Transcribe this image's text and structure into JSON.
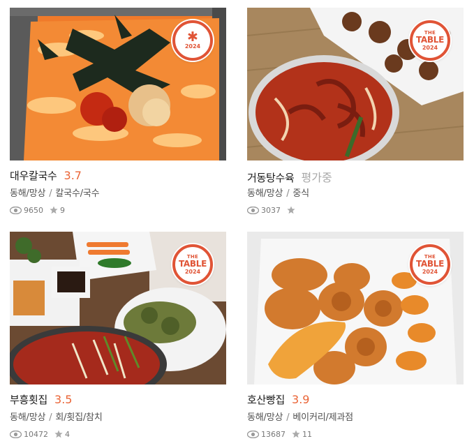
{
  "restaurants": [
    {
      "name": "대우칼국수",
      "rating": "3.7",
      "location": "동해/망상",
      "category": "칼국수/국수",
      "views": "9650",
      "reviews": "9",
      "badge": {
        "type": "star",
        "symbol": "✱",
        "year": "2024"
      },
      "image": "spicy-noodle-soup-photo"
    },
    {
      "name": "거동탕수육",
      "rating": "평가중",
      "location": "동해/망상",
      "category": "중식",
      "views": "3037",
      "reviews": "",
      "badge": {
        "type": "table",
        "the": "THE",
        "table": "TABLE",
        "year": "2024"
      },
      "image": "jjamppong-and-fried-dish-photo"
    },
    {
      "name": "부흥횟집",
      "rating": "3.5",
      "location": "동해/망상",
      "category": "회/횟집/참치",
      "views": "10472",
      "reviews": "4",
      "badge": {
        "type": "table",
        "the": "THE",
        "table": "TABLE",
        "year": "2024"
      },
      "image": "raw-fish-side-dishes-photo"
    },
    {
      "name": "호산빵집",
      "rating": "3.9",
      "location": "동해/망상",
      "category": "베이커리/제과점",
      "views": "13687",
      "reviews": "11",
      "badge": {
        "type": "table",
        "the": "THE",
        "table": "TABLE",
        "year": "2024"
      },
      "image": "donuts-in-takeout-box-photo"
    }
  ],
  "separator": "/",
  "colors": {
    "accent": "#ea6436",
    "badge": "#e05436",
    "pending": "#a8a8a8"
  }
}
